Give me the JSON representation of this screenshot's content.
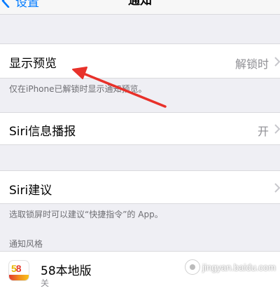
{
  "nav": {
    "back_label": "设置",
    "title": "通知"
  },
  "show_previews": {
    "label": "显示预览",
    "value": "解锁时",
    "footnote": "仅在iPhone已解锁时显示通知预览。"
  },
  "siri_announce": {
    "label": "Siri信息播报",
    "value": "开"
  },
  "siri_suggestions": {
    "label": "Siri建议",
    "footnote": "选取锁屏时可以建议“快捷指令”的 App。"
  },
  "notification_style": {
    "header": "通知风格"
  },
  "apps": [
    {
      "name": "58本地版",
      "icon": "58-app-icon",
      "detail_partial": "关"
    }
  ],
  "watermark": {
    "text": "jingyan.baidu.com",
    "brand_icon": "baidu-paw-icon"
  },
  "colors": {
    "accent": "#007aff",
    "annotation_arrow": "#e8312a",
    "background": "#efeff4"
  }
}
